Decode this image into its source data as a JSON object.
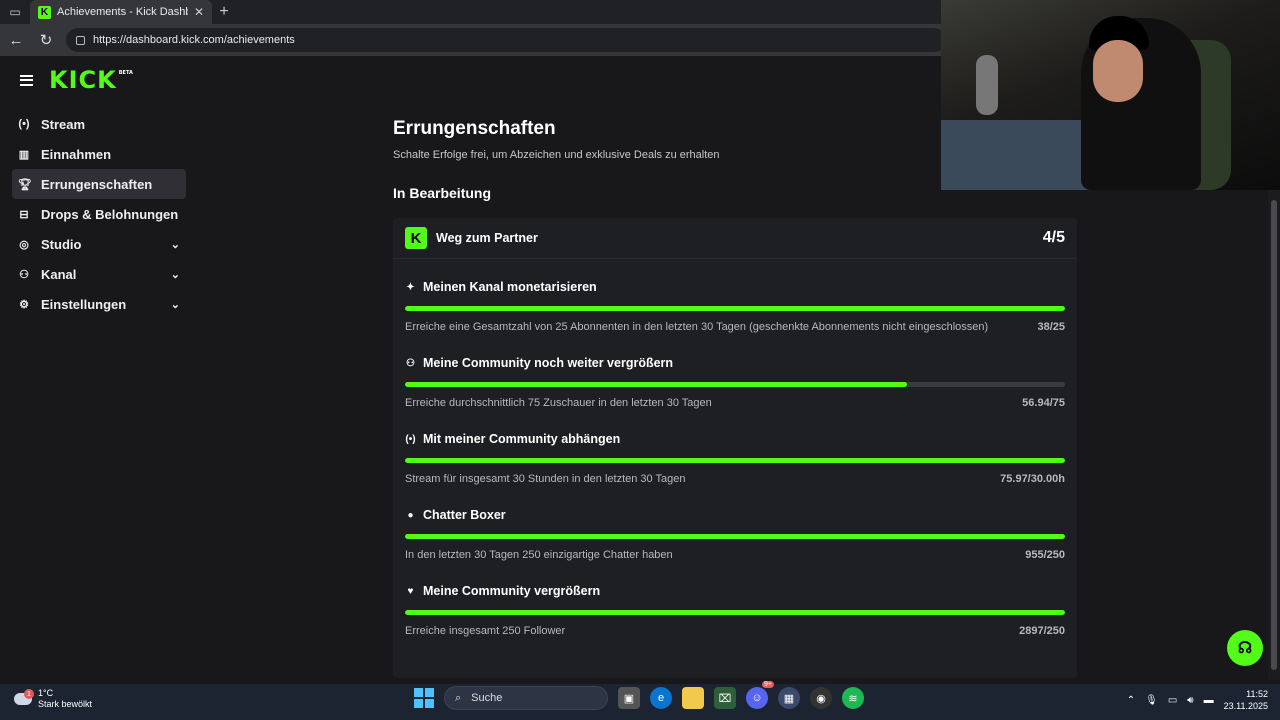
{
  "browser": {
    "tab_title": "Achievements - Kick Dashboard",
    "url": "https://dashboard.kick.com/achievements"
  },
  "brand": {
    "logo": "KICK",
    "beta": "BETA",
    "accent": "#53fc18"
  },
  "sidebar": {
    "items": [
      {
        "label": "Stream",
        "icon": "broadcast-icon"
      },
      {
        "label": "Einnahmen",
        "icon": "chart-icon"
      },
      {
        "label": "Errungenschaften",
        "icon": "trophy-icon",
        "active": true
      },
      {
        "label": "Drops & Belohnungen",
        "icon": "gift-icon"
      },
      {
        "label": "Studio",
        "icon": "studio-icon",
        "expandable": true
      },
      {
        "label": "Kanal",
        "icon": "users-icon",
        "expandable": true
      },
      {
        "label": "Einstellungen",
        "icon": "gear-icon",
        "expandable": true
      }
    ]
  },
  "main": {
    "title": "Errungenschaften",
    "subtitle": "Schalte Erfolge frei, um Abzeichen und exklusive Deals zu erhalten",
    "section_title": "In Bearbeitung",
    "card": {
      "title": "Weg zum Partner",
      "progress": "4/5",
      "goals": [
        {
          "title": "Meinen Kanal monetarisieren",
          "icon": "sparkle-icon",
          "desc": "Erreiche eine Gesamtzahl von 25 Abonnenten in den letzten 30 Tagen (geschenkte Abonnements nicht eingeschlossen)",
          "value": "38/25",
          "fraction": 1.0
        },
        {
          "title": "Meine Community noch weiter vergrößern",
          "icon": "users-icon",
          "desc": "Erreiche durchschnittlich 75 Zuschauer in den letzten 30 Tagen",
          "value": "56.94/75",
          "fraction": 0.76
        },
        {
          "title": "Mit meiner Community abhängen",
          "icon": "broadcast-icon",
          "desc": "Stream für insgesamt 30 Stunden in den letzten 30 Tagen",
          "value": "75.97/30.00h",
          "fraction": 1.0
        },
        {
          "title": "Chatter Boxer",
          "icon": "chat-icon",
          "desc": "In den letzten 30 Tagen 250 einzigartige Chatter haben",
          "value": "955/250",
          "fraction": 1.0
        },
        {
          "title": "Meine Community vergrößern",
          "icon": "heart-icon",
          "desc": "Erreiche insgesamt 250 Follower",
          "value": "2897/250",
          "fraction": 1.0
        }
      ]
    }
  },
  "taskbar": {
    "temp": "1°C",
    "weather": "Stark bewölkt",
    "weather_badge": "1",
    "search_placeholder": "Suche",
    "time": "11:52",
    "date": "23.11.2025",
    "discord_badge": "9+"
  }
}
